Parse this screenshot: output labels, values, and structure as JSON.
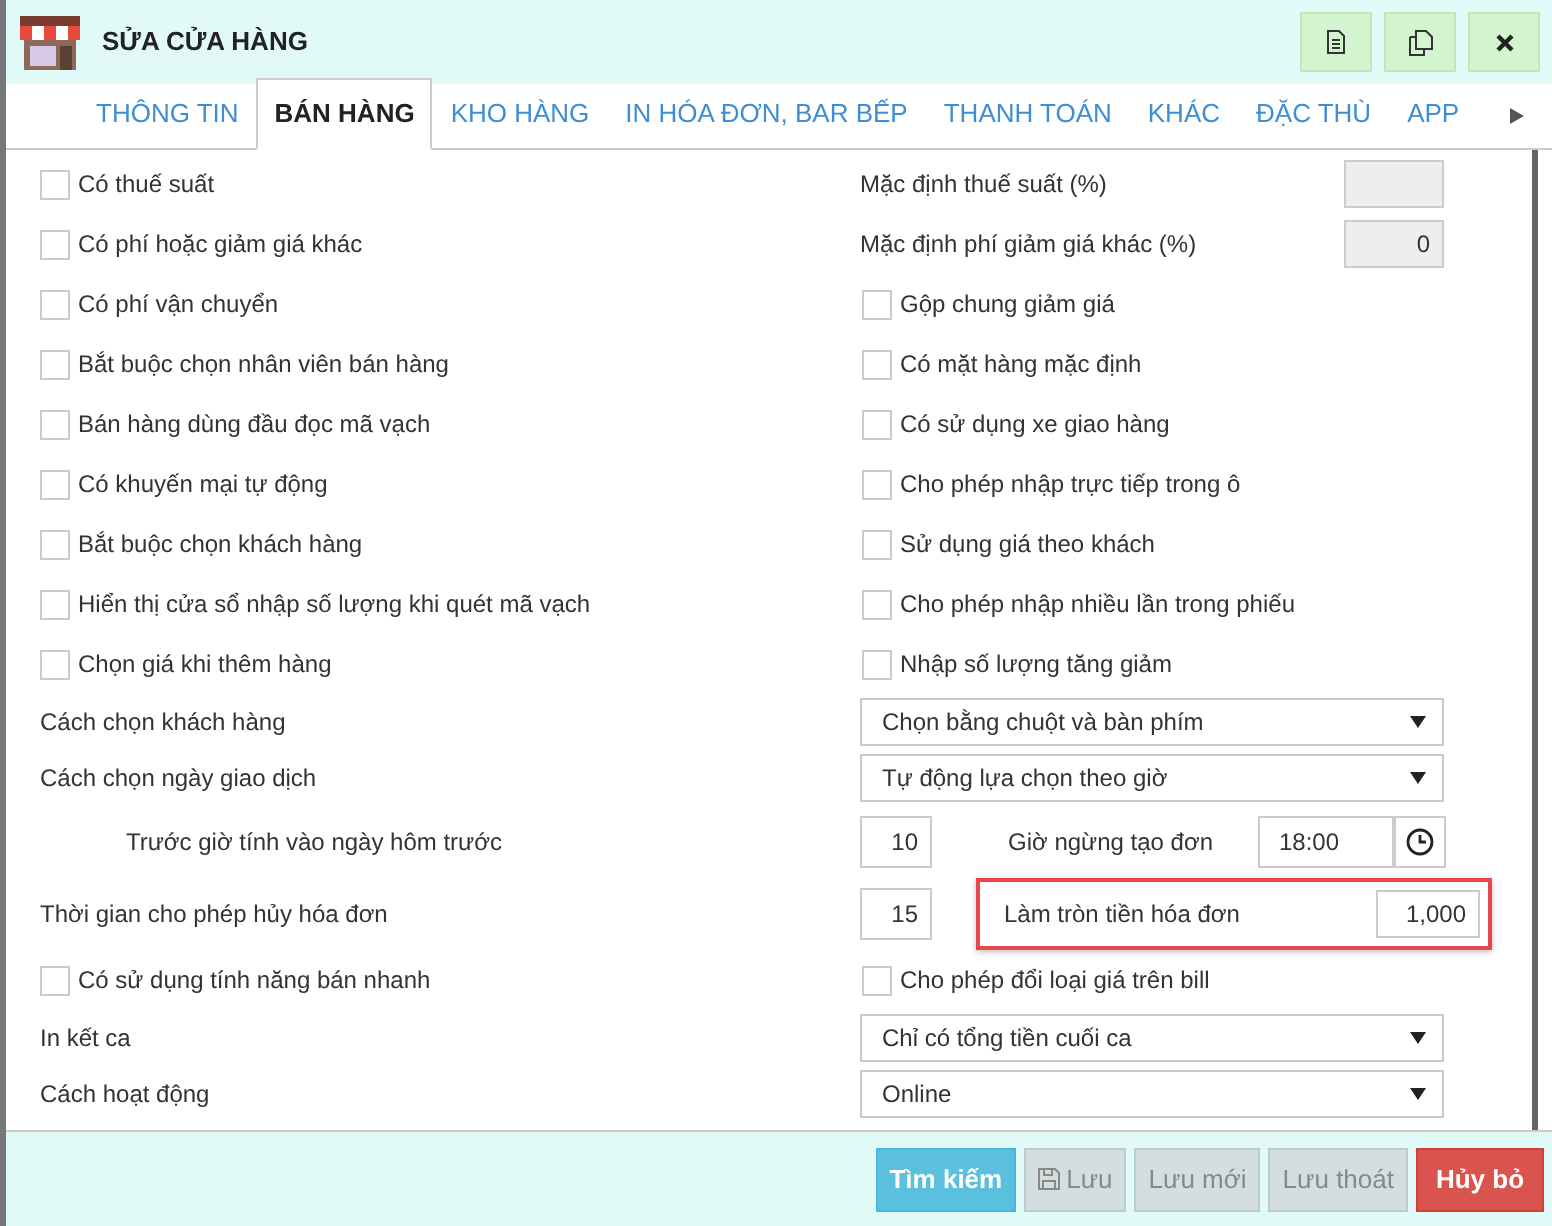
{
  "window": {
    "title": "SỬA CỬA HÀNG"
  },
  "tabs": [
    {
      "label": "THÔNG TIN",
      "selected": false
    },
    {
      "label": "BÁN HÀNG",
      "selected": true
    },
    {
      "label": "KHO HÀNG",
      "selected": false
    },
    {
      "label": "IN HÓA ĐƠN, BAR BẾP",
      "selected": false
    },
    {
      "label": "THANH TOÁN",
      "selected": false
    },
    {
      "label": "KHÁC",
      "selected": false
    },
    {
      "label": "ĐẶC THÙ",
      "selected": false
    },
    {
      "label": "APP",
      "selected": false
    }
  ],
  "rows": [
    {
      "kind": "pair",
      "left": {
        "kind": "checkbox",
        "label": "Có thuế suất",
        "checked": false
      },
      "right": {
        "kind": "field",
        "label": "Mặc định thuế suất (%)",
        "disabled": true
      }
    },
    {
      "kind": "pair",
      "left": {
        "kind": "checkbox",
        "label": "Có phí hoặc giảm giá khác",
        "checked": false
      },
      "right": {
        "kind": "field",
        "label": "Mặc định phí giảm giá khác (%)",
        "value": "0",
        "disabled": true
      }
    },
    {
      "kind": "pair",
      "left": {
        "kind": "checkbox",
        "label": "Có phí vận chuyển",
        "checked": false
      },
      "right": {
        "kind": "checkbox",
        "label": "Gộp chung giảm giá",
        "checked": false
      }
    },
    {
      "kind": "pair",
      "left": {
        "kind": "checkbox",
        "label": "Bắt buộc chọn nhân viên bán hàng",
        "checked": false
      },
      "right": {
        "kind": "checkbox",
        "label": "Có mặt hàng mặc định",
        "checked": false
      }
    },
    {
      "kind": "pair",
      "left": {
        "kind": "checkbox",
        "label": "Bán hàng dùng đầu đọc mã vạch",
        "checked": false
      },
      "right": {
        "kind": "checkbox",
        "label": "Có sử dụng xe giao hàng",
        "checked": false
      }
    },
    {
      "kind": "pair",
      "left": {
        "kind": "checkbox",
        "label": "Có khuyến mại tự động",
        "checked": false
      },
      "right": {
        "kind": "checkbox",
        "label": "Cho phép nhập trực tiếp trong ô",
        "checked": false
      }
    },
    {
      "kind": "pair",
      "left": {
        "kind": "checkbox",
        "label": "Bắt buộc chọn khách hàng",
        "checked": false
      },
      "right": {
        "kind": "checkbox",
        "label": "Sử dụng giá theo khách",
        "checked": false
      }
    },
    {
      "kind": "pair",
      "left": {
        "kind": "checkbox",
        "label": "Hiển thị cửa sổ nhập số lượng khi quét mã vạch",
        "checked": false
      },
      "right": {
        "kind": "checkbox",
        "label": "Cho phép nhập nhiều lần trong phiếu",
        "checked": false
      }
    },
    {
      "kind": "pair",
      "left": {
        "kind": "checkbox",
        "label": "Chọn giá khi thêm hàng",
        "checked": false
      },
      "right": {
        "kind": "checkbox",
        "label": "Nhập số lượng tăng giảm",
        "checked": false
      }
    },
    {
      "kind": "select",
      "label": "Cách chọn khách hàng",
      "value": "Chọn bằng chuột và bàn phím"
    },
    {
      "kind": "select",
      "label": "Cách chọn ngày giao dịch",
      "value": "Tự động lựa chọn theo giờ"
    },
    {
      "kind": "number",
      "label": "Trước giờ tính vào ngày hôm trước",
      "indented": true,
      "value": "10",
      "extra": {
        "kind": "time",
        "label": "Giờ ngừng tạo đơn",
        "value": "18:00",
        "highlighted": false
      }
    },
    {
      "kind": "number",
      "label": "Thời gian cho phép hủy hóa đơn",
      "indented": false,
      "value": "15",
      "extra": {
        "kind": "amount",
        "label": "Làm tròn tiền hóa đơn",
        "value": "1,000",
        "highlighted": true
      }
    },
    {
      "kind": "pair",
      "left": {
        "kind": "checkbox",
        "label": "Có sử dụng tính năng bán nhanh",
        "checked": false
      },
      "right": {
        "kind": "checkbox",
        "label": "Cho phép đổi loại giá trên bill",
        "checked": false
      }
    },
    {
      "kind": "select",
      "label": "In kết ca",
      "value": "Chỉ có tổng tiền cuối ca"
    },
    {
      "kind": "select",
      "label": "Cách hoạt động",
      "value": "Online"
    }
  ],
  "buttons": [
    {
      "kind": "search",
      "label": "Tìm kiếm",
      "disabled": false
    },
    {
      "kind": "save",
      "label": "Lưu",
      "disabled": true
    },
    {
      "kind": "plain",
      "label": "Lưu mới",
      "disabled": true
    },
    {
      "kind": "plain",
      "label": "Lưu thoát",
      "disabled": true
    },
    {
      "kind": "cancel",
      "label": "Hủy bỏ",
      "disabled": false
    }
  ]
}
